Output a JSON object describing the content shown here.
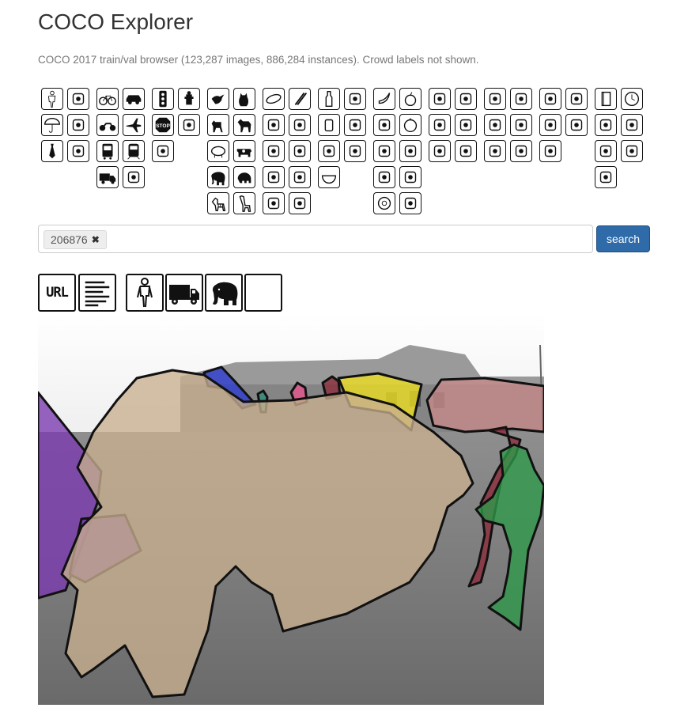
{
  "app": {
    "title": "COCO Explorer",
    "subtitle": "COCO 2017 train/val browser (123,287 images, 886,284 instances). Crowd labels not shown."
  },
  "categories": [
    "person-icon",
    "backpack-icon",
    "bicycle-icon",
    "car-icon",
    "traffic-light-icon",
    "fire-hydrant-icon",
    "bird-icon",
    "cat-icon",
    "frisbee-icon",
    "skis-icon",
    "bottle-icon",
    "wine-glass-icon",
    "banana-icon",
    "apple-icon",
    "chair-icon",
    "couch-icon",
    "tv-icon",
    "laptop-icon",
    "microwave-icon",
    "oven-icon",
    "book-icon",
    "clock-icon",
    "umbrella-icon",
    "handbag-icon",
    "motorcycle-icon",
    "airplane-icon",
    "stop-sign-icon",
    "parking-meter-icon",
    "dog-icon",
    "horse-icon",
    "snowboard-icon",
    "sports-ball-icon",
    "cup-icon",
    "fork-icon",
    "sandwich-icon",
    "orange-icon",
    "potted-plant-icon",
    "bed-icon",
    "mouse-icon",
    "remote-icon",
    "toaster-icon",
    "sink-icon",
    "vase-icon",
    "scissors-icon",
    "tie-icon",
    "suitcase-icon",
    "bus-icon",
    "train-icon",
    "bench-icon",
    "sheep-icon",
    "cow-icon",
    "kite-icon",
    "baseball-bat-icon",
    "knife-icon",
    "spoon-icon",
    "broccoli-icon",
    "carrot-icon",
    "dining-table-icon",
    "toilet-icon",
    "keyboard-icon",
    "cell-phone-icon",
    "refrigerator-icon",
    "teddy-bear-icon",
    "hair-drier-icon",
    "truck-icon",
    "boat-icon",
    "elephant-icon",
    "bear-icon",
    "baseball-glove-icon",
    "skateboard-icon",
    "bowl-icon",
    "hot-dog-icon",
    "pizza-icon",
    "toothbrush-icon",
    "zebra-icon",
    "giraffe-icon",
    "surfboard-icon",
    "tennis-racket-icon",
    "donut-icon",
    "cake-icon"
  ],
  "search": {
    "tag_label": "206876",
    "remove_symbol": "✖",
    "button_label": "search"
  },
  "toolbar": {
    "url_label": "URL",
    "items": [
      "url-icon",
      "caption-icon",
      "person-icon",
      "truck-icon",
      "elephant-icon",
      "blank-toggle"
    ]
  },
  "image_viewer": {
    "image_id": "206876",
    "segments": [
      {
        "category": "elephant",
        "color": "#c8b08e"
      },
      {
        "category": "person",
        "color": "#2e9a4a"
      },
      {
        "category": "person",
        "color": "#8a2a3a"
      },
      {
        "category": "person",
        "color": "#e8558d"
      },
      {
        "category": "person",
        "color": "#2e8a7a"
      },
      {
        "category": "truck",
        "color": "#f0e020"
      },
      {
        "category": "truck",
        "color": "#c88a8a"
      },
      {
        "category": "truck",
        "color": "#7a3ab0"
      },
      {
        "category": "kite",
        "color": "#2a3ad0"
      }
    ]
  }
}
